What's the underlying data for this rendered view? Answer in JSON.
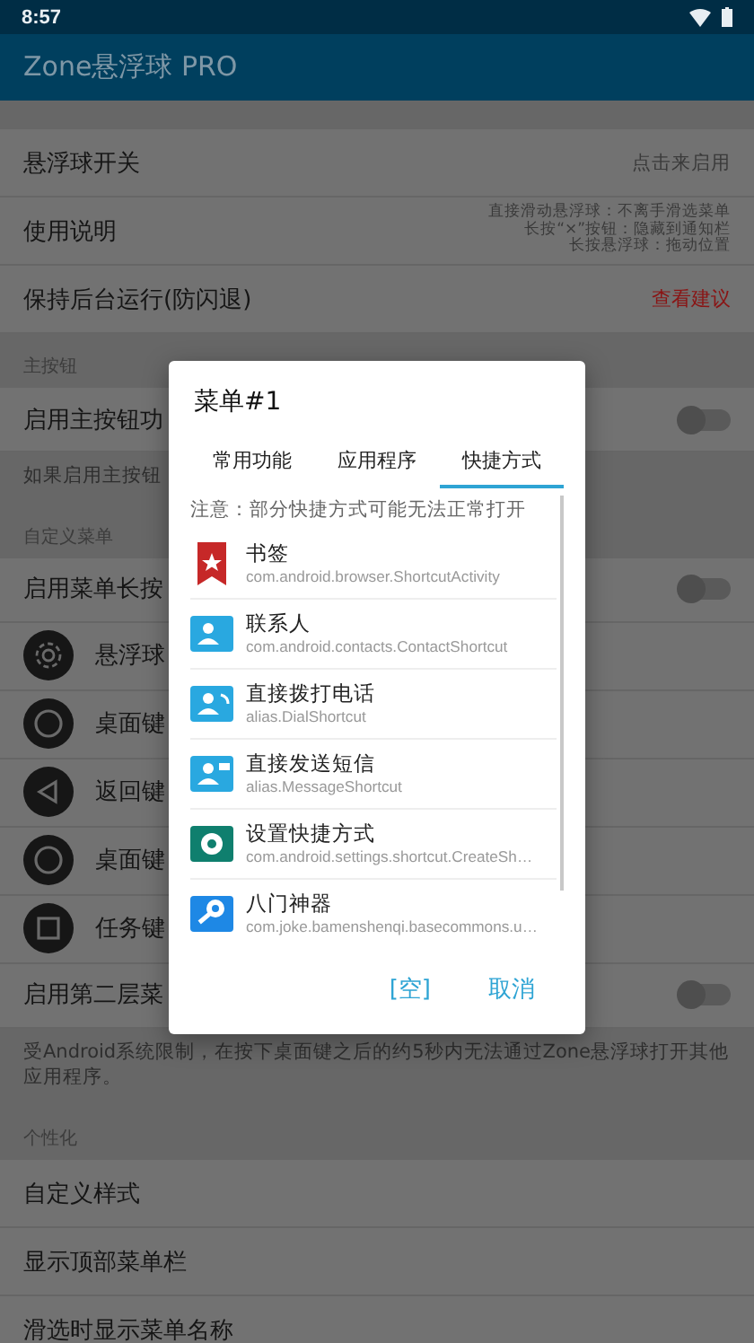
{
  "status_bar": {
    "time": "8:57"
  },
  "app_bar": {
    "title": "Zone悬浮球 PRO"
  },
  "sections": [
    {
      "rows": [
        {
          "kind": "value",
          "label": "悬浮球开关",
          "value": "点击来启用"
        },
        {
          "kind": "help",
          "label": "使用说明",
          "lines": [
            "直接滑动悬浮球：不离手滑选菜单",
            "长按“×”按钮：隐藏到通知栏",
            "长按悬浮球：拖动位置"
          ]
        },
        {
          "kind": "link",
          "label": "保持后台运行(防闪退)",
          "value": "查看建议"
        }
      ]
    },
    {
      "header": "主按钮",
      "rows": [
        {
          "kind": "toggle",
          "label": "启用主按钮功",
          "on": false
        },
        {
          "kind": "note",
          "label": "如果启用主按钮"
        }
      ]
    },
    {
      "header": "自定义菜单",
      "rows": [
        {
          "kind": "toggle",
          "label": "启用菜单长按",
          "on": false
        },
        {
          "kind": "gear",
          "label": "悬浮球"
        },
        {
          "kind": "circle",
          "label": "桌面键"
        },
        {
          "kind": "back",
          "label": "返回键"
        },
        {
          "kind": "circle",
          "label": "桌面键"
        },
        {
          "kind": "square",
          "label": "任务键"
        },
        {
          "kind": "toggle",
          "label": "启用第二层菜",
          "on": false
        },
        {
          "kind": "note",
          "label": "受Android系统限制，在按下桌面键之后的约5秒内无法通过Zone悬浮球打开其他应用程序。"
        }
      ]
    },
    {
      "header": "个性化",
      "rows": [
        {
          "kind": "plain",
          "label": "自定义样式"
        },
        {
          "kind": "plain",
          "label": "显示顶部菜单栏"
        },
        {
          "kind": "plain",
          "label": "滑选时显示菜单名称"
        }
      ]
    }
  ],
  "dialog": {
    "title": "菜单#1",
    "tabs": [
      {
        "label": "常用功能",
        "selected": false
      },
      {
        "label": "应用程序",
        "selected": false
      },
      {
        "label": "快捷方式",
        "selected": true
      }
    ],
    "notice": "注意：部分快捷方式可能无法正常打开",
    "items": [
      {
        "kind": "bookmark",
        "color": "#c62828",
        "title": "书签",
        "subtitle": "com.android.browser.ShortcutActivity"
      },
      {
        "kind": "contact",
        "color": "#29a8e0",
        "title": "联系人",
        "subtitle": "com.android.contacts.ContactShortcut"
      },
      {
        "kind": "dial",
        "color": "#29a8e0",
        "title": "直接拨打电话",
        "subtitle": "alias.DialShortcut"
      },
      {
        "kind": "message",
        "color": "#29a8e0",
        "title": "直接发送短信",
        "subtitle": "alias.MessageShortcut"
      },
      {
        "kind": "gear",
        "color": "#0f7f6e",
        "title": "设置快捷方式",
        "subtitle": "com.android.settings.shortcut.CreateSh…"
      },
      {
        "kind": "key",
        "color": "#1e88e5",
        "title": "八门神器",
        "subtitle": "com.joke.bamenshenqi.basecommons.u…"
      }
    ],
    "buttons": [
      "[空]",
      "取消"
    ]
  }
}
